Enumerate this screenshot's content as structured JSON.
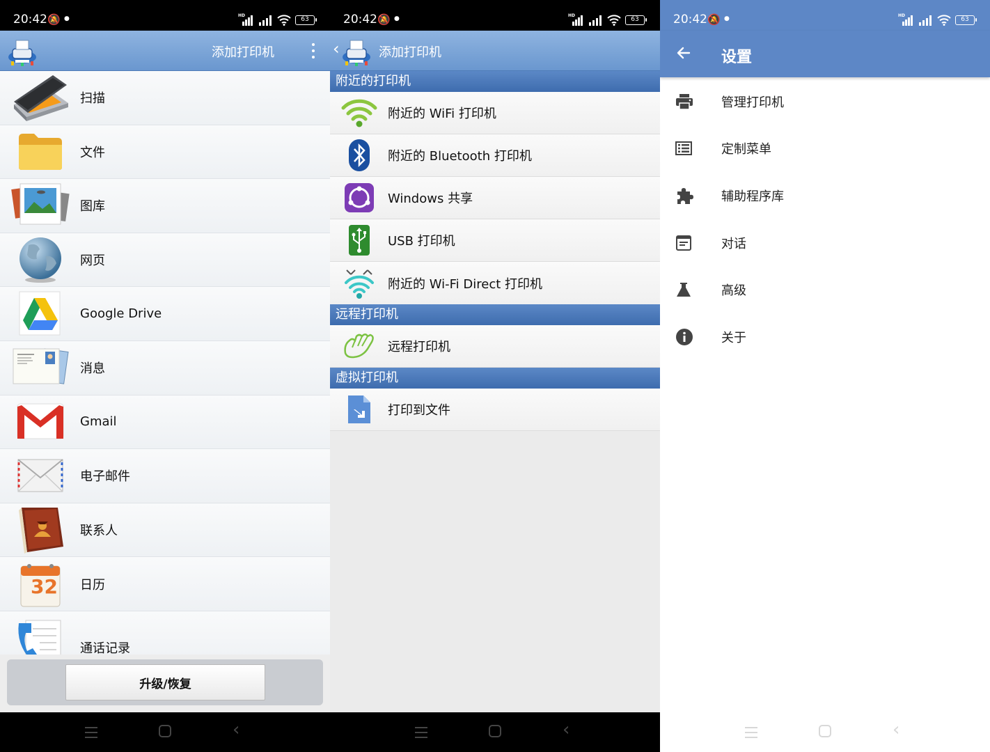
{
  "status_bar": {
    "time": "20:42",
    "battery": "63"
  },
  "panel_main": {
    "title": "添加打印机",
    "items": [
      {
        "label": "扫描",
        "icon": "scanner-icon"
      },
      {
        "label": "文件",
        "icon": "folder-icon"
      },
      {
        "label": "图库",
        "icon": "gallery-icon"
      },
      {
        "label": "网页",
        "icon": "globe-icon"
      },
      {
        "label": "Google Drive",
        "icon": "google-drive-icon"
      },
      {
        "label": "消息",
        "icon": "messages-icon"
      },
      {
        "label": "Gmail",
        "icon": "gmail-icon"
      },
      {
        "label": "电子邮件",
        "icon": "envelope-icon"
      },
      {
        "label": "联系人",
        "icon": "contacts-book-icon"
      },
      {
        "label": "日历",
        "icon": "calendar-icon"
      },
      {
        "label": "通话记录",
        "icon": "phone-icon"
      }
    ],
    "calendar_day": "32",
    "upgrade_button": "升级/恢复"
  },
  "panel_add_printer": {
    "title": "添加打印机",
    "sections": [
      {
        "header": "附近的打印机",
        "items": [
          {
            "label": "附近的 WiFi 打印机",
            "icon": "wifi-icon"
          },
          {
            "label": "附近的 Bluetooth 打印机",
            "icon": "bluetooth-icon"
          },
          {
            "label": "Windows 共享",
            "icon": "windows-share-icon"
          },
          {
            "label": "USB 打印机",
            "icon": "usb-icon"
          },
          {
            "label": "附近的 Wi-Fi Direct 打印机",
            "icon": "wifi-direct-icon"
          }
        ]
      },
      {
        "header": "远程打印机",
        "items": [
          {
            "label": "远程打印机",
            "icon": "remote-hand-icon"
          }
        ]
      },
      {
        "header": "虚拟打印机",
        "items": [
          {
            "label": "打印到文件",
            "icon": "print-to-file-icon"
          }
        ]
      }
    ]
  },
  "panel_settings": {
    "title": "设置",
    "items": [
      {
        "label": "管理打印机",
        "icon": "printer-icon"
      },
      {
        "label": "定制菜单",
        "icon": "list-icon"
      },
      {
        "label": "辅助程序库",
        "icon": "puzzle-icon"
      },
      {
        "label": "对话",
        "icon": "dialog-icon"
      },
      {
        "label": "高级",
        "icon": "flask-icon"
      },
      {
        "label": "关于",
        "icon": "info-icon"
      }
    ]
  }
}
